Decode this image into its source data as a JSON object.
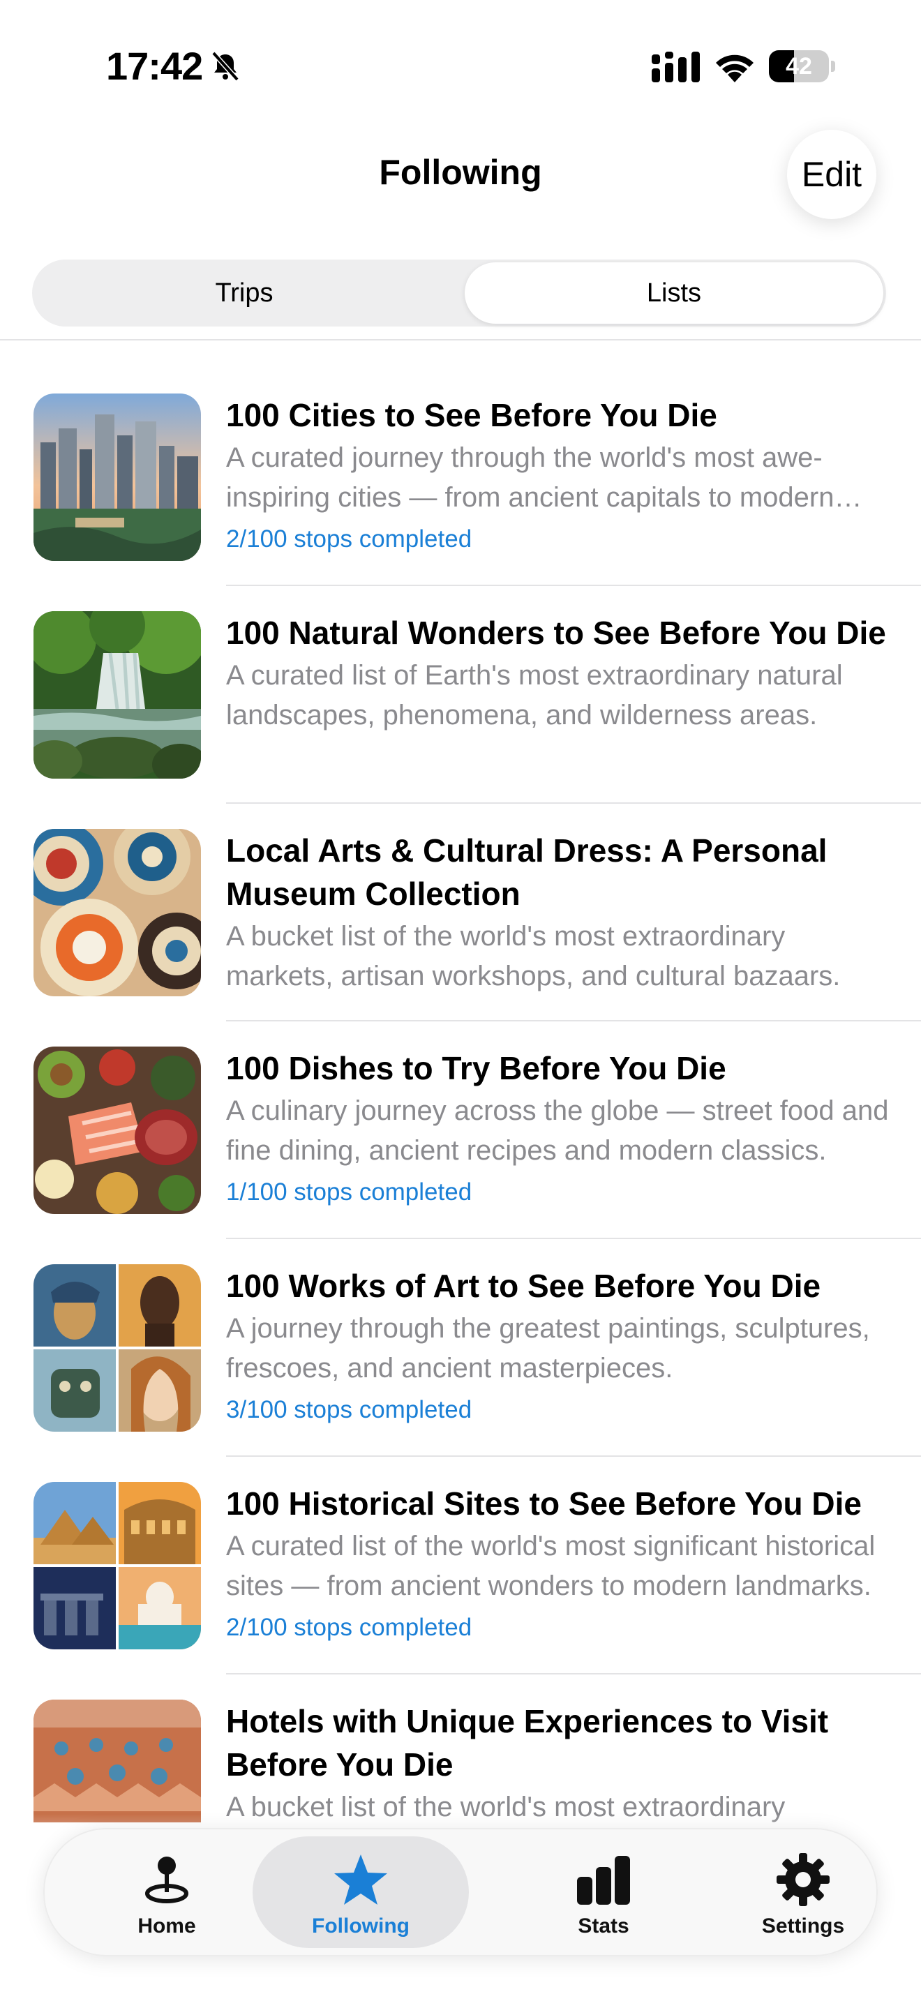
{
  "status_bar": {
    "time": "17:42",
    "battery_level": "42",
    "battery_fraction": 0.42
  },
  "header": {
    "title": "Following",
    "edit_label": "Edit"
  },
  "segmented": {
    "options": [
      "Trips",
      "Lists"
    ],
    "selected": "Lists"
  },
  "lists": [
    {
      "title": "100 Cities to See Before You Die",
      "description": "A curated journey through the world's most awe-inspiring cities — from ancient capitals to modern metropolises.",
      "progress": "2/100 stops completed",
      "thumbnail": "city-skyline"
    },
    {
      "title": "100 Natural Wonders to See Before You Die",
      "description": "A curated list of Earth's most extraordinary natural landscapes, phenomena, and wilderness areas.",
      "progress": "",
      "thumbnail": "waterfall"
    },
    {
      "title": "Local Arts & Cultural Dress: A Personal Museum Collection",
      "description": "A bucket list of the world's most extraordinary markets, artisan workshops, and cultural bazaars.",
      "progress": "",
      "thumbnail": "woven-baskets"
    },
    {
      "title": "100 Dishes to Try Before You Die",
      "description": "A culinary journey across the globe — street food and fine dining, ancient recipes and modern classics.",
      "progress": "1/100 stops completed",
      "thumbnail": "food-spread"
    },
    {
      "title": "100 Works of Art to See Before You Die",
      "description": "A journey through the greatest paintings, sculptures, frescoes, and ancient masterpieces.",
      "progress": "3/100 stops completed",
      "thumbnail": "art-collage"
    },
    {
      "title": "100 Historical Sites to See Before You Die",
      "description": "A curated list of the world's most significant historical sites — from ancient wonders to modern landmarks.",
      "progress": "2/100 stops completed",
      "thumbnail": "historical-collage"
    },
    {
      "title": "Hotels with Unique Experiences to Visit Before You Die",
      "description": "A bucket list of the world's most extraordinary",
      "progress": "",
      "thumbnail": "desert-camp"
    }
  ],
  "tab_bar": {
    "home": "Home",
    "following": "Following",
    "stats": "Stats",
    "settings": "Settings",
    "active": "Following",
    "accent_color": "#1a7fd6"
  }
}
